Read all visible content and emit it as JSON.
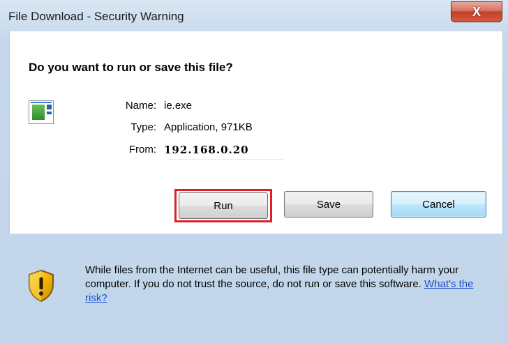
{
  "window": {
    "title": "File Download - Security Warning",
    "close_glyph": "X"
  },
  "dialog": {
    "heading": "Do you want to run or save this file?",
    "file": {
      "icon": "application-file-icon",
      "name_label": "Name:",
      "name_value": "ie.exe",
      "type_label": "Type:",
      "type_value": "Application, 971KB",
      "from_label": "From:",
      "from_value": "192.168.0.20"
    },
    "buttons": {
      "run": "Run",
      "save": "Save",
      "cancel": "Cancel"
    },
    "highlight_color": "#e01e2a"
  },
  "warning": {
    "icon": "shield-warning-icon",
    "text": "While files from the Internet can be useful, this file type can potentially harm your computer. If you do not trust the source, do not run or save this software.",
    "link": "What's the risk?"
  }
}
